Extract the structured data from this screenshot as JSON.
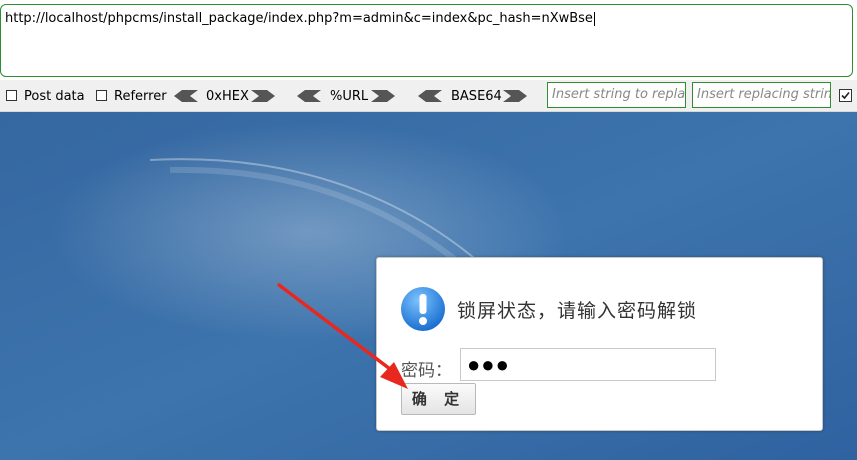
{
  "url_bar": {
    "value": "http://localhost/phpcms/install_package/index.php?m=admin&c=index&pc_hash=nXwBse"
  },
  "toolbar": {
    "post_data_label": "Post data",
    "referrer_label": "Referrer",
    "hex_label": "0xHEX",
    "url_label": "%URL",
    "base64_label": "BASE64",
    "insert_string_placeholder": "Insert string to replace",
    "insert_replacing_placeholder": "Insert replacing string",
    "post_data_checked": false,
    "referrer_checked": false,
    "replace_checked": true
  },
  "lock_dialog": {
    "title": "锁屏状态，请输入密码解锁",
    "password_label": "密码：",
    "password_value": "●●●",
    "confirm_label": "确 定"
  },
  "colors": {
    "background_blue": "#3a6ea5",
    "input_border_green": "#2f8f2f",
    "arrow_red": "#e8281e",
    "info_icon_blue": "#2a8ae6"
  }
}
